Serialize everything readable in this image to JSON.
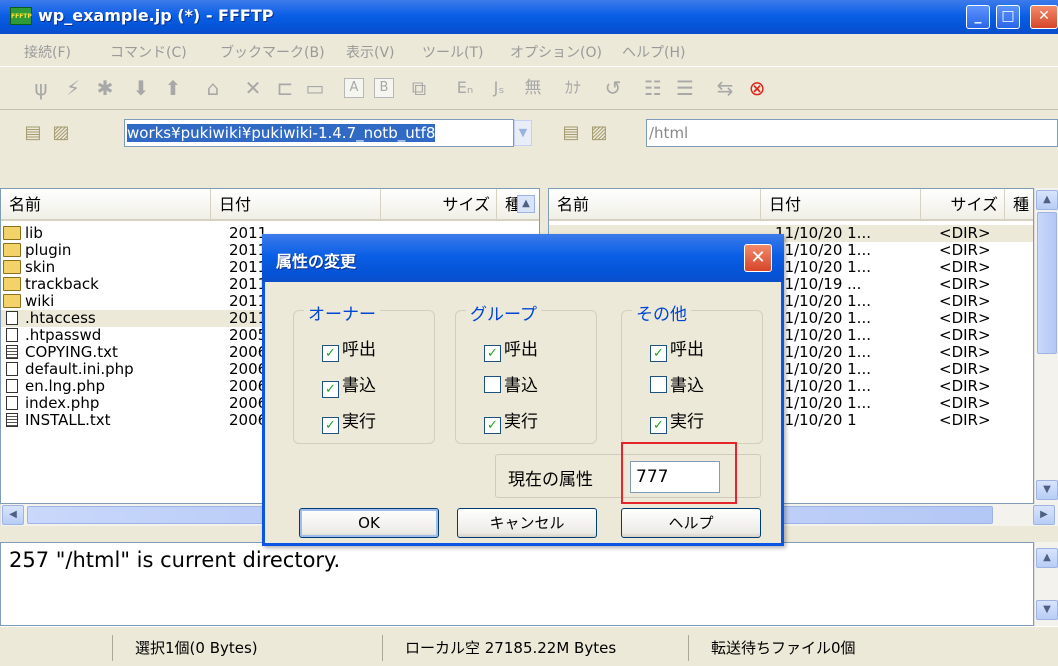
{
  "window": {
    "title": "wp_example.jp (*) - FFFTP",
    "app_icon": "FFFTP",
    "minimize": "_",
    "maximize": "□",
    "close": "✕"
  },
  "menu": [
    {
      "label": "接続(F)"
    },
    {
      "label": "コマンド(C)"
    },
    {
      "label": "ブックマーク(B)"
    },
    {
      "label": "表示(V)"
    },
    {
      "label": "ツール(T)"
    },
    {
      "label": "オプション(O)"
    },
    {
      "label": "ヘルプ(H)"
    }
  ],
  "toolbar": {
    "b_label": "B",
    "a_label": "A",
    "text_mode_label": "Eₙ",
    "jis_label": "Jₛ",
    "no_conv_label": "無",
    "kana_label": "ｶﾅ",
    "connect_icon": "plug-icon",
    "disconnect_icon": "disconnect-icon",
    "stop_icon": "stop-icon"
  },
  "local": {
    "path_prefix": "works¥pukiwiki¥pukiwiki-1.4.7_notb_utf8",
    "columns": [
      "名前",
      "日付",
      "サイズ",
      "種"
    ],
    "rows": [
      {
        "name": "lib",
        "date": "2011",
        "type": "folder"
      },
      {
        "name": "plugin",
        "date": "2011",
        "type": "folder"
      },
      {
        "name": "skin",
        "date": "2011",
        "type": "folder"
      },
      {
        "name": "trackback",
        "date": "2011",
        "type": "folder"
      },
      {
        "name": "wiki",
        "date": "2011",
        "type": "folder"
      },
      {
        "name": ".htaccess",
        "date": "2011",
        "type": "file"
      },
      {
        "name": ".htpasswd",
        "date": "2005",
        "type": "file"
      },
      {
        "name": "COPYING.txt",
        "date": "2006",
        "type": "txt"
      },
      {
        "name": "default.ini.php",
        "date": "2006",
        "type": "file"
      },
      {
        "name": "en.lng.php",
        "date": "2006",
        "type": "file"
      },
      {
        "name": "index.php",
        "date": "2006",
        "type": "file"
      },
      {
        "name": "INSTALL.txt",
        "date": "2006",
        "type": "txt"
      }
    ]
  },
  "remote": {
    "path": "/html",
    "columns": [
      "名前",
      "日付",
      "サイズ",
      "種"
    ],
    "rows": [
      {
        "date": "11/10/20 1...",
        "size": "<DIR>"
      },
      {
        "date": "11/10/20 1...",
        "size": "<DIR>"
      },
      {
        "date": "11/10/20 1...",
        "size": "<DIR>"
      },
      {
        "date": "11/10/19 ...",
        "size": "<DIR>"
      },
      {
        "date": "11/10/20 1...",
        "size": "<DIR>"
      },
      {
        "date": "11/10/20 1...",
        "size": "<DIR>"
      },
      {
        "date": "11/10/20 1...",
        "size": "<DIR>"
      },
      {
        "date": "11/10/20 1...",
        "size": "<DIR>"
      },
      {
        "date": "11/10/20 1...",
        "size": "<DIR>"
      },
      {
        "date": "11/10/20 1...",
        "size": "<DIR>"
      },
      {
        "date": "11/10/20 1...",
        "size": "<DIR>"
      },
      {
        "date": "11/10/20 1",
        "size": "<DIR>"
      }
    ]
  },
  "log": {
    "line": "257 \"/html\" is current directory."
  },
  "status": {
    "selection": "選択1個(0 Bytes)",
    "local_free": "ローカル空 27185.22M Bytes",
    "queue": "転送待ちファイル0個"
  },
  "dialog": {
    "title": "属性の変更",
    "close": "✕",
    "groups": [
      {
        "label": "オーナー",
        "read": {
          "label": "呼出",
          "checked": true
        },
        "write": {
          "label": "書込",
          "checked": true
        },
        "exec": {
          "label": "実行",
          "checked": true
        }
      },
      {
        "label": "グループ",
        "read": {
          "label": "呼出",
          "checked": true
        },
        "write": {
          "label": "書込",
          "checked": false
        },
        "exec": {
          "label": "実行",
          "checked": true
        }
      },
      {
        "label": "その他",
        "read": {
          "label": "呼出",
          "checked": true
        },
        "write": {
          "label": "書込",
          "checked": false
        },
        "exec": {
          "label": "実行",
          "checked": true
        }
      }
    ],
    "attr_label": "現在の属性",
    "attr_value": "777",
    "ok": "OK",
    "cancel": "キャンセル",
    "help": "ヘルプ",
    "highlight_color": "#e8242b"
  }
}
